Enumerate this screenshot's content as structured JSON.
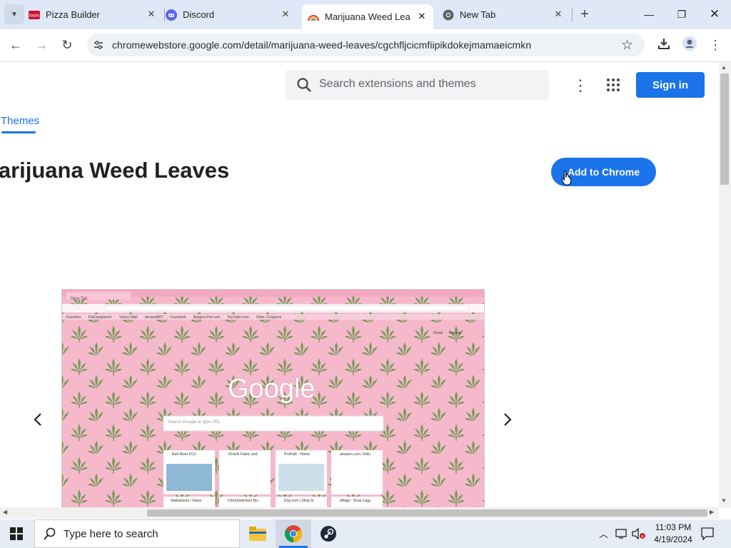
{
  "browser": {
    "tabs": [
      {
        "title": "Pizza Builder",
        "favicon": "papa-johns-icon",
        "active": false
      },
      {
        "title": "Discord",
        "favicon": "discord-icon",
        "active": false
      },
      {
        "title": "Marijuana Weed Leav",
        "favicon": "rainbow-icon",
        "active": true
      },
      {
        "title": "New Tab",
        "favicon": "chrome-icon",
        "active": false
      }
    ],
    "url": "chromewebstore.google.com/detail/marijuana-weed-leaves/cgchfljcicmfiipikdokejmamaeicmkn"
  },
  "store": {
    "search_placeholder": "Search extensions and themes",
    "signin_label": "Sign in",
    "themes_tab": "Themes",
    "title": "Marijuana Weed Leaves",
    "add_button": "Add to Chrome"
  },
  "preview": {
    "tab_label": "New Tab",
    "google_logo": "Google",
    "search_hint": "Search Google or type URL",
    "bookmarks": [
      "Favorites",
      "PetCompanion",
      "Yahoo! Mail",
      "deviantART",
      "Facebook",
      "Adopt-a-Pet.com",
      "YouTube.com",
      "Olive / Coupons"
    ],
    "top_links": [
      "Gmail",
      "Images"
    ],
    "tiles": [
      "Red River FCU",
      "JOcloN Fabric and",
      "ProPath - Home",
      "amazon.com: Onlin"
    ],
    "tiles_row2": [
      "Walkabouts | Swiss",
      "ChickSwitchers Bo...",
      "Etsy.com | Shop fo",
      "eBags - Shop Lugg"
    ]
  },
  "taskbar": {
    "search_placeholder": "Type here to search",
    "time": "11:03 PM",
    "date": "4/19/2024"
  },
  "colors": {
    "accent": "#1a73e8",
    "tabbar": "#dfe8f6",
    "preview_pink": "#f6b9cc",
    "leaf_green": "#7a9a5a"
  }
}
